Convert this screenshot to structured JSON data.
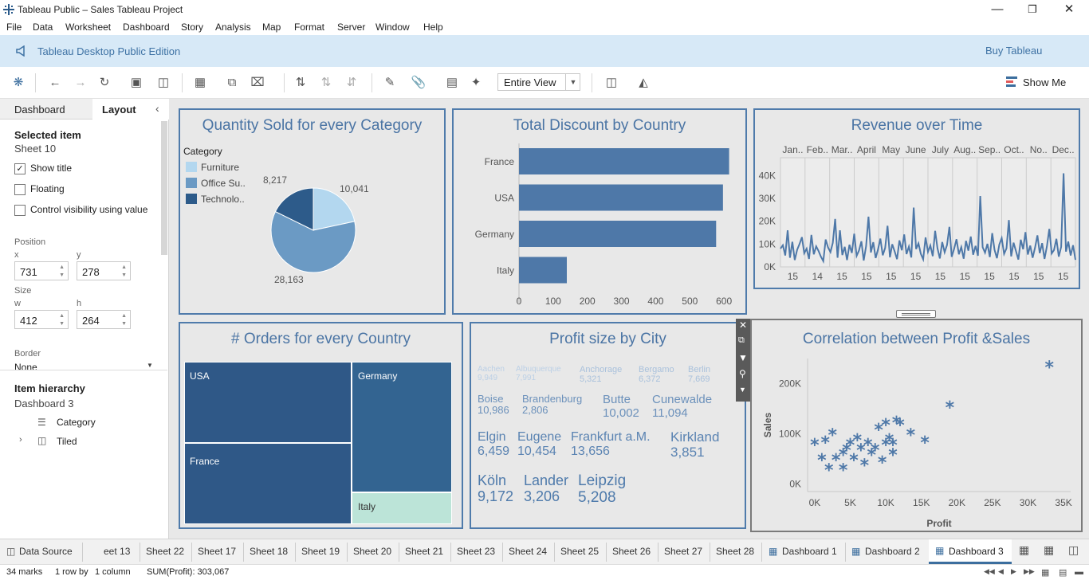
{
  "window": {
    "title": "Tableau Public – Sales Tableau Project"
  },
  "menu": [
    "File",
    "Data",
    "Worksheet",
    "Dashboard",
    "Story",
    "Analysis",
    "Map",
    "Format",
    "Server",
    "Window",
    "Help"
  ],
  "banner": {
    "edition": "Tableau Desktop Public Edition",
    "buy": "Buy Tableau"
  },
  "toolbar": {
    "fit_value": "Entire View",
    "show_me": "Show Me"
  },
  "left_pane": {
    "tabs": [
      "Dashboard",
      "Layout"
    ],
    "selected_item_label": "Selected item",
    "selected_item_value": "Sheet 10",
    "show_title": "Show title",
    "floating": "Floating",
    "control_visibility": "Control visibility using value",
    "position_label": "Position",
    "x_label": "x",
    "y_label": "y",
    "x_value": "731",
    "y_value": "278",
    "size_label": "Size",
    "w_label": "w",
    "h_label": "h",
    "w_value": "412",
    "h_value": "264",
    "border_label": "Border",
    "border_value": "None",
    "hierarchy_label": "Item hierarchy",
    "hierarchy_root": "Dashboard 3",
    "hierarchy_items": [
      "Category",
      "Tiled"
    ]
  },
  "pie": {
    "title": "Quantity Sold for every Category",
    "legend_title": "Category",
    "legend": [
      {
        "label": "Furniture",
        "color": "#b3d7ef"
      },
      {
        "label": "Office Su..",
        "color": "#6b9ac4"
      },
      {
        "label": "Technolo..",
        "color": "#2d5b8a"
      }
    ],
    "labels": {
      "furniture": "10,041",
      "office": "28,163",
      "tech": "8,217"
    }
  },
  "discount": {
    "title": "Total Discount by Country"
  },
  "revenue": {
    "title": "Revenue over Time",
    "months": [
      "Jan..",
      "Feb..",
      "Mar..",
      "April",
      "May",
      "June",
      "July",
      "Aug..",
      "Sep..",
      "Oct..",
      "No..",
      "Dec.."
    ],
    "days": [
      "15",
      "14",
      "15",
      "15",
      "15",
      "15",
      "15",
      "15",
      "15",
      "15",
      "15",
      "15"
    ],
    "y_ticks": [
      "40K",
      "30K",
      "20K",
      "10K",
      "0K"
    ]
  },
  "orders": {
    "title": "# Orders for every Country",
    "cells": [
      "USA",
      "Germany",
      "France",
      "Italy"
    ]
  },
  "profit_city": {
    "title": "Profit size by City",
    "cities": [
      {
        "name": "Aachen",
        "value": "9,949"
      },
      {
        "name": "Albuquerque",
        "value": "7,991"
      },
      {
        "name": "Anchorage",
        "value": "5,321"
      },
      {
        "name": "Bergamo",
        "value": "6,372"
      },
      {
        "name": "Berlin",
        "value": "7,669"
      },
      {
        "name": "Boise",
        "value": "10,986"
      },
      {
        "name": "Brandenburg",
        "value": "2,806"
      },
      {
        "name": "Butte",
        "value": "10,002"
      },
      {
        "name": "Cunewalde",
        "value": "11,094"
      },
      {
        "name": "Elgin",
        "value": "6,459"
      },
      {
        "name": "Eugene",
        "value": "10,454"
      },
      {
        "name": "Frankfurt a.M.",
        "value": "13,656"
      },
      {
        "name": "Kirkland",
        "value": "3,851"
      },
      {
        "name": "Köln",
        "value": "9,172"
      },
      {
        "name": "Lander",
        "value": "3,206"
      },
      {
        "name": "Leipzig",
        "value": "5,208"
      }
    ]
  },
  "scatter": {
    "title": "Correlation between Profit &Sales",
    "xlabel": "Profit",
    "ylabel": "Sales",
    "x_ticks": [
      "0K",
      "5K",
      "10K",
      "15K",
      "20K",
      "25K",
      "30K",
      "35K"
    ],
    "y_ticks": [
      "200K",
      "100K",
      "0K"
    ]
  },
  "chart_data": [
    {
      "type": "pie",
      "title": "Quantity Sold for every Category",
      "categories": [
        "Furniture",
        "Office Su..",
        "Technolo.."
      ],
      "values": [
        10041,
        28163,
        8217
      ]
    },
    {
      "type": "bar",
      "title": "Total Discount by Country",
      "categories": [
        "France",
        "USA",
        "Germany",
        "Italy"
      ],
      "values": [
        615,
        597,
        577,
        140
      ],
      "xlim": [
        0,
        630
      ],
      "x_ticks": [
        "0",
        "100",
        "200",
        "300",
        "400",
        "500",
        "600"
      ]
    },
    {
      "type": "line",
      "title": "Revenue over Time",
      "ylim": [
        0,
        45000
      ],
      "ticks": [
        0,
        10000,
        20000,
        30000,
        40000
      ],
      "values": [
        8000,
        9500,
        5000,
        16000,
        4000,
        11000,
        3000,
        7500,
        10000,
        13000,
        6000,
        8000,
        3500,
        14000,
        5500,
        9000,
        7000,
        4500,
        2500,
        12000,
        8500,
        6500,
        10500,
        21000,
        4000,
        16000,
        5200,
        8800,
        3000,
        9700,
        6100,
        14500,
        4800,
        7200,
        11200,
        2800,
        9100,
        22000,
        6300,
        10800,
        3900,
        7600,
        12400,
        5100,
        8300,
        18000,
        4200,
        9900,
        6800,
        3400,
        11600,
        7300,
        14200,
        5600,
        8900,
        4100,
        26000,
        7800,
        10300,
        5800,
        3300,
        12900,
        6600,
        9400,
        4700,
        15800,
        8200,
        3700,
        10900,
        6400,
        9600,
        17500,
        4400,
        7900,
        12100,
        5500,
        8700,
        3600,
        11400,
        7100,
        13300,
        5300,
        9200,
        4900,
        31000,
        8600,
        6200,
        10100,
        4300,
        14800,
        7500,
        3800,
        9800,
        12600,
        5700,
        8100,
        20500,
        4600,
        10600,
        6900,
        3200,
        11900,
        7700,
        15200,
        5400,
        9300,
        4000,
        8400,
        13800,
        6000,
        10400,
        3500,
        9000,
        16600,
        5900,
        7400,
        12300,
        4500,
        8800,
        41000,
        6700,
        11100,
        5000,
        9500,
        3100
      ]
    },
    {
      "type": "heatmap",
      "title": "# Orders for every Country",
      "categories": [
        "USA",
        "Germany",
        "France",
        "Italy"
      ]
    },
    {
      "type": "scatter",
      "title": "Correlation between Profit &Sales",
      "xlabel": "Profit",
      "ylabel": "Sales",
      "xlim": [
        -1000,
        36000
      ],
      "ylim": [
        -15000,
        250000
      ],
      "points": [
        [
          0,
          80000
        ],
        [
          1000,
          50000
        ],
        [
          1500,
          85000
        ],
        [
          2000,
          30000
        ],
        [
          2500,
          100000
        ],
        [
          3000,
          50000
        ],
        [
          4000,
          30000
        ],
        [
          4000,
          60000
        ],
        [
          4500,
          70000
        ],
        [
          5000,
          80000
        ],
        [
          5500,
          50000
        ],
        [
          6000,
          90000
        ],
        [
          6500,
          70000
        ],
        [
          7000,
          40000
        ],
        [
          7500,
          80000
        ],
        [
          8000,
          60000
        ],
        [
          8500,
          70000
        ],
        [
          9000,
          110000
        ],
        [
          9500,
          45000
        ],
        [
          10000,
          80000
        ],
        [
          10000,
          120000
        ],
        [
          10500,
          90000
        ],
        [
          11000,
          60000
        ],
        [
          11000,
          80000
        ],
        [
          11500,
          125000
        ],
        [
          12000,
          120000
        ],
        [
          13500,
          100000
        ],
        [
          15500,
          85000
        ],
        [
          19000,
          155000
        ],
        [
          33000,
          235000
        ]
      ]
    }
  ],
  "sheet_tabs": [
    "Data Source",
    "eet 13",
    "Sheet 22",
    "Sheet 17",
    "Sheet 18",
    "Sheet 19",
    "Sheet 20",
    "Sheet 21",
    "Sheet 23",
    "Sheet 24",
    "Sheet 25",
    "Sheet 26",
    "Sheet 27",
    "Sheet 28",
    "Dashboard 1",
    "Dashboard 2",
    "Dashboard 3"
  ],
  "status": {
    "marks": "34 marks",
    "rows": "1 row by",
    "cols": "1 column",
    "sum": "SUM(Profit): 303,067"
  }
}
